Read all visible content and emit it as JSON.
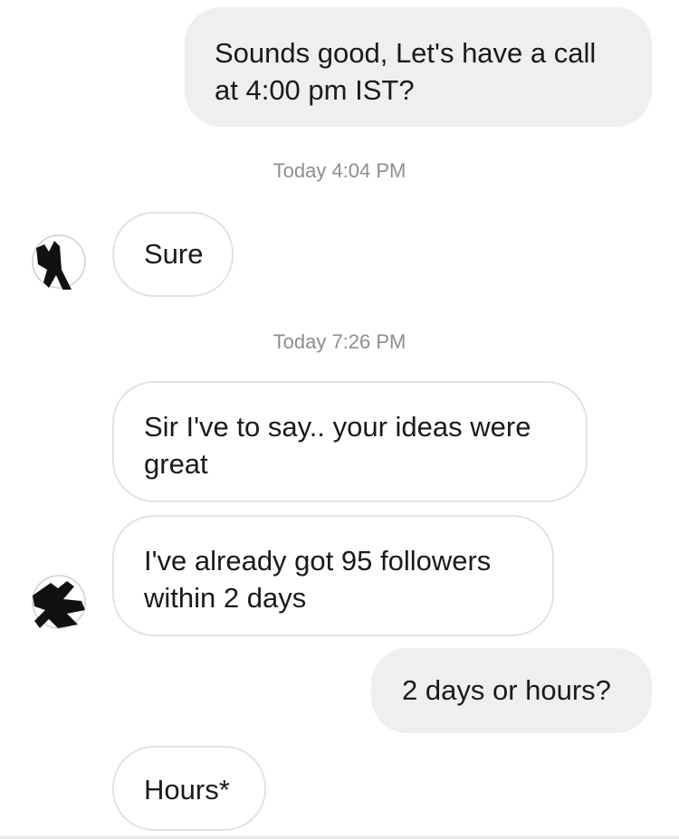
{
  "messages": [
    {
      "from": "me",
      "text": "Sounds good, Let's have a call\nat 4:00 pm IST?"
    },
    {
      "timestamp": "Today 4:04 PM"
    },
    {
      "from": "them",
      "text": "Sure"
    },
    {
      "timestamp": "Today 7:26 PM"
    },
    {
      "from": "them",
      "text": "Sir I've to say.. your ideas were\ngreat"
    },
    {
      "from": "them",
      "text": "I've already got 95 followers\nwithin 2 days"
    },
    {
      "from": "me",
      "text": "2 days or hours?"
    },
    {
      "from": "them",
      "text": "Hours*"
    }
  ],
  "avatar_icon": "profile-avatar-icon",
  "colors": {
    "sent_bubble": "#efefef",
    "received_border": "#e2e2e2",
    "timestamp": "#8e8e8e",
    "text": "#1a1a1a"
  }
}
